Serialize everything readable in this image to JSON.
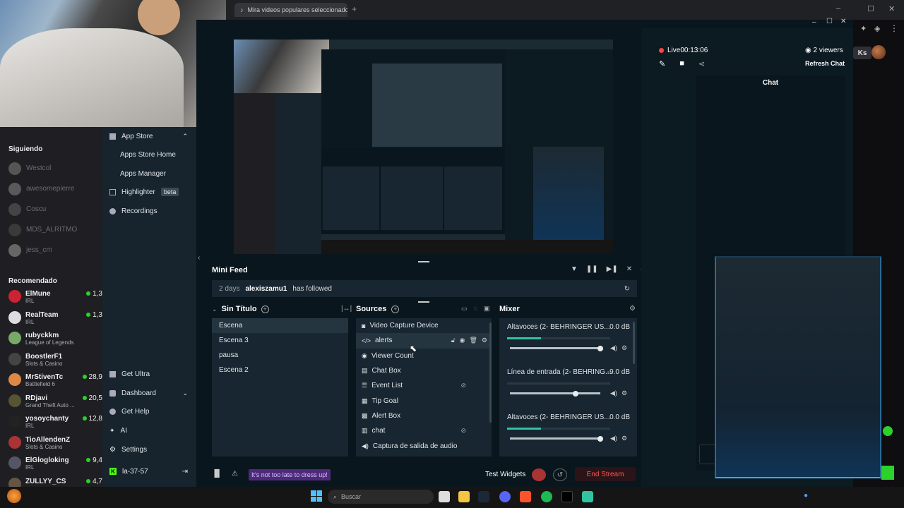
{
  "browser": {
    "tab_title": "Mira videos populares seleccionados",
    "new_tab": "+",
    "min": "–",
    "max": "☐",
    "close": "✕",
    "right_badge": "Ks"
  },
  "twitch_sidebar": {
    "following_header": "Siguiendo",
    "following": [
      "Westcol",
      "awesomepierre",
      "Coscu",
      "MDS_ALRITMO",
      "jess_cm"
    ],
    "recommended_header": "Recomendado",
    "recommended": [
      {
        "name": "ElMune",
        "game": "IRL",
        "viewers": "1,3",
        "color": "#c23"
      },
      {
        "name": "RealTeam",
        "game": "IRL",
        "viewers": "1,3",
        "color": "#ddd"
      },
      {
        "name": "rubyckkm",
        "game": "League of Legends",
        "viewers": "",
        "color": "#7a6"
      },
      {
        "name": "BoostlerF1",
        "game": "Slots & Casino",
        "viewers": "",
        "color": "#444"
      },
      {
        "name": "MrStivenTc",
        "game": "Battlefield 6",
        "viewers": "28,9",
        "color": "#d84"
      },
      {
        "name": "RDjavi",
        "game": "Grand Theft Auto ...",
        "viewers": "20,5",
        "color": "#553"
      },
      {
        "name": "yosoychanty",
        "game": "IRL",
        "viewers": "12,8",
        "color": "#222"
      },
      {
        "name": "TioAllendenZ",
        "game": "Slots & Casino",
        "viewers": "",
        "color": "#a33"
      },
      {
        "name": "ElGlogloking",
        "game": "IRL",
        "viewers": "9,4",
        "color": "#556"
      },
      {
        "name": "ZULLYY_CS",
        "game": "",
        "viewers": "4,7",
        "color": "#654"
      }
    ]
  },
  "sl_nav": {
    "app_store": "App Store",
    "app_store_home": "Apps Store Home",
    "apps_manager": "Apps Manager",
    "highlighter": "Highlighter",
    "beta": "beta",
    "recordings": "Recordings",
    "get_ultra": "Get Ultra",
    "dashboard": "Dashboard",
    "get_help": "Get Help",
    "ai": "AI",
    "settings": "Settings",
    "user": "la-37-57"
  },
  "header": {
    "live": "Live00:13:06",
    "viewers": "2 viewers",
    "refresh_chat": "Refresh Chat",
    "chat_title": "Chat"
  },
  "minifeed": {
    "title": "Mini Feed",
    "time": "2 days",
    "user": "alexiszamu1",
    "action": "has followed"
  },
  "scenes": {
    "title": "Sin Título",
    "items": [
      "Escena",
      "Escena 3",
      "pausa",
      "Escena 2"
    ],
    "selected": 0
  },
  "sources": {
    "title": "Sources",
    "items": [
      "Video Capture Device",
      "alerts",
      "Viewer Count",
      "Chat Box",
      "Event List",
      "Tip Goal",
      "Alert Box",
      "chat",
      "Captura de salida de audio"
    ],
    "selected": 1
  },
  "mixer": {
    "title": "Mixer",
    "channels": [
      {
        "name": "Altavoces (2- BEHRINGER US...",
        "db": "0.0 dB",
        "level": 0.33,
        "volume": 1.0
      },
      {
        "name": "Línea de entrada (2- BEHRING...",
        "db": "-9.0 dB",
        "level": 0,
        "volume": 0.73
      },
      {
        "name": "Altavoces (2- BEHRINGER US...",
        "db": "0.0 dB",
        "level": 0.33,
        "volume": 1.0
      }
    ]
  },
  "bottom": {
    "promo": "It's not too late to dress up!",
    "test_widgets": "Test Widgets",
    "end_stream": "End Stream"
  },
  "taskbar": {
    "search_placeholder": "Buscar"
  },
  "colors": {
    "accent": "#31c3a2",
    "live_red": "#f44444",
    "twitch_purple": "#9147ff"
  }
}
